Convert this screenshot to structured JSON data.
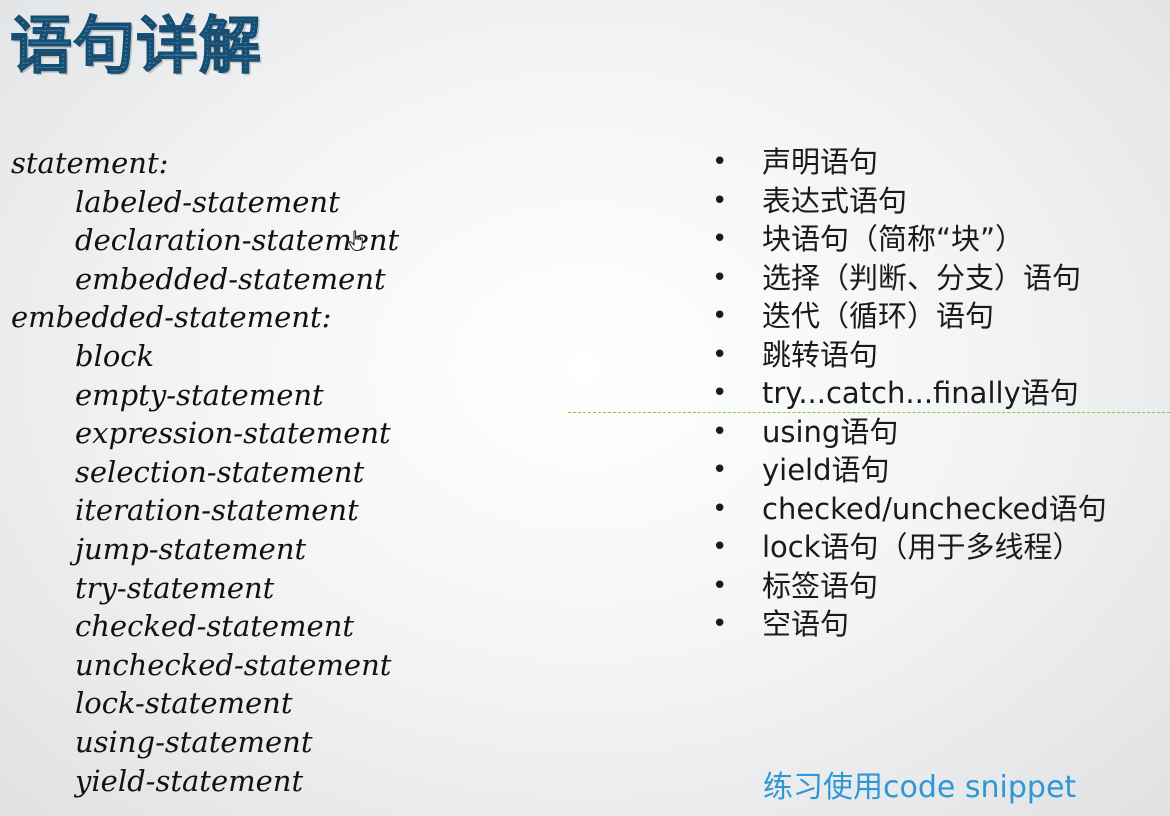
{
  "title": "语句详解",
  "grammar": [
    {
      "text": "statement:",
      "indent": false
    },
    {
      "text": "labeled-statement",
      "indent": true
    },
    {
      "text": "declaration-statement",
      "indent": true
    },
    {
      "text": "embedded-statement",
      "indent": true
    },
    {
      "text": "embedded-statement:",
      "indent": false
    },
    {
      "text": "block",
      "indent": true
    },
    {
      "text": "empty-statement",
      "indent": true
    },
    {
      "text": "expression-statement",
      "indent": true
    },
    {
      "text": "selection-statement",
      "indent": true
    },
    {
      "text": "iteration-statement",
      "indent": true
    },
    {
      "text": "jump-statement",
      "indent": true
    },
    {
      "text": "try-statement",
      "indent": true
    },
    {
      "text": "checked-statement",
      "indent": true
    },
    {
      "text": "unchecked-statement",
      "indent": true
    },
    {
      "text": "lock-statement",
      "indent": true
    },
    {
      "text": "using-statement",
      "indent": true
    },
    {
      "text": "yield-statement",
      "indent": true
    }
  ],
  "bullet_symbol": "•",
  "statement_types": [
    "声明语句",
    "表达式语句",
    "块语句（简称“块”）",
    "选择（判断、分支）语句",
    "迭代（循环）语句",
    "跳转语句",
    "try...catch...finally语句",
    "using语句",
    "yield语句",
    "checked/unchecked语句",
    "lock语句（用于多线程）",
    "标签语句",
    "空语句"
  ],
  "footer_link": "练习使用code snippet",
  "colors": {
    "title": "#2f6f9a",
    "link": "#2f97d6",
    "divider": "#8cc63f"
  },
  "icons": {
    "cursor": "hand-pointer-icon"
  }
}
